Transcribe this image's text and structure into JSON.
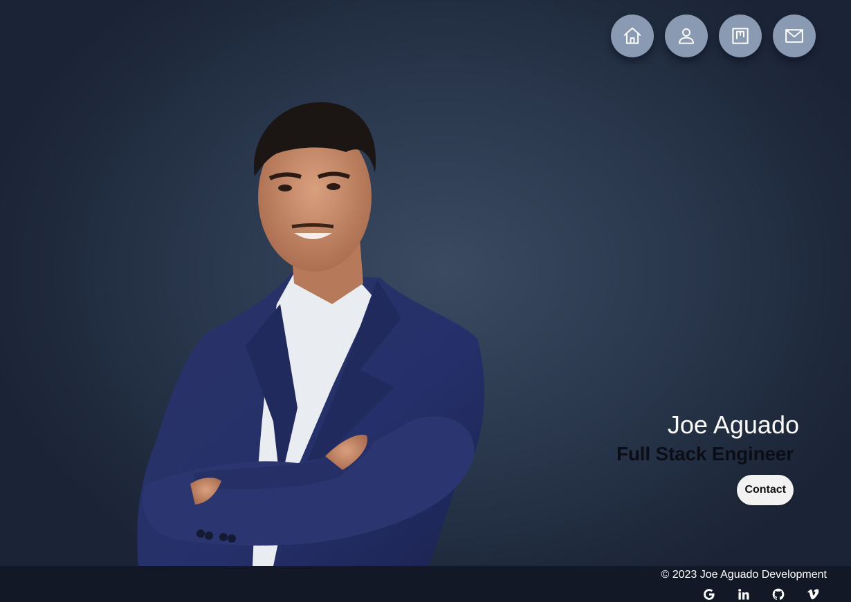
{
  "nav": {
    "items": [
      {
        "icon": "home-icon"
      },
      {
        "icon": "user-icon"
      },
      {
        "icon": "projects-icon"
      },
      {
        "icon": "mail-icon"
      }
    ]
  },
  "hero": {
    "name": "Joe Aguado",
    "title": "Full Stack Engineer",
    "contact_label": "Contact"
  },
  "footer": {
    "copyright": "© 2023 Joe Aguado Development",
    "social": [
      {
        "icon": "google-icon"
      },
      {
        "icon": "linkedin-icon"
      },
      {
        "icon": "github-icon"
      },
      {
        "icon": "vimeo-icon"
      }
    ]
  },
  "colors": {
    "background": "#2c3a50",
    "nav_button": "#8a9ab3",
    "footer": "#121826",
    "title": "#0b0e16"
  }
}
